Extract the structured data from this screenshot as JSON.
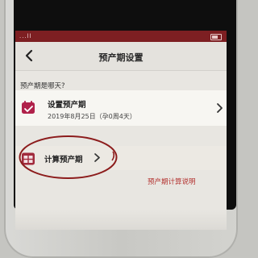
{
  "status_bar": {
    "signal_text": "...ll"
  },
  "nav": {
    "title": "预产期设置",
    "back_icon": "chevron-left-icon"
  },
  "question": "预产期是哪天?",
  "set_due_date": {
    "label": "设置预产期",
    "date_text": "2019年8月25日（孕0周4天）",
    "icon": "calendar-icon"
  },
  "calculate_due_date": {
    "label": "计算预产期",
    "icon": "calendar-grid-icon"
  },
  "help_link": "预产期计算说明",
  "colors": {
    "brand_red": "#7d1f22",
    "link_red": "#b3312f",
    "annotation_red": "#8c1c1c"
  }
}
